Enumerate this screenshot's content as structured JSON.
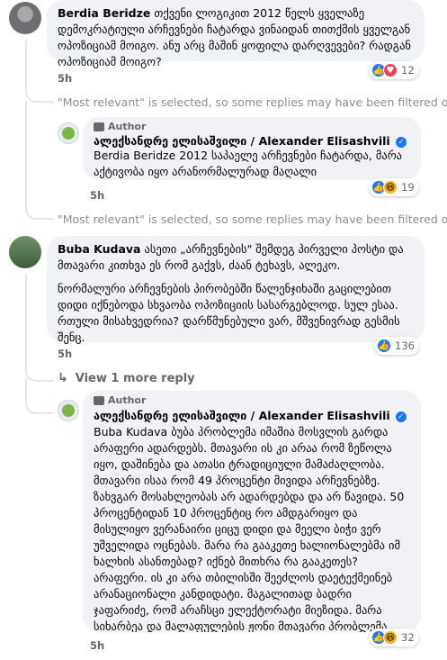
{
  "comment1": {
    "author": "Berdia Beridze",
    "text": "თქვენი ლოგიკით 2012 წელს ყველაზე დემოკრატიული არჩევნები ჩატარდა ვინაიდან თითქმის ყველგან ოპოზიციამ მოიგო. ანუ არც მაშინ ყოფილა დარღვევები? რადგან ოპოზიციამ მოიგო?",
    "time": "5h",
    "reactions": {
      "icons": [
        "like-icon",
        "love-icon"
      ],
      "count": "12"
    }
  },
  "filter_notice_1": "\"Most relevant\" is selected, so some replies may have been filtered out.",
  "reply1": {
    "badge": "Author",
    "author": "ალექსანდრე ელისაშვილი / Alexander Elisashvili",
    "text": "Berdia Beridze 2012 საპაელე არჩევნები ჩატარდა, მარა აქტივობა იყო არანორმალურად მაღალი",
    "time": "5h",
    "reactions": {
      "icons": [
        "like-icon",
        "haha-icon"
      ],
      "count": "19"
    }
  },
  "filter_notice_2": "\"Most relevant\" is selected, so some replies may have been filtered out.",
  "comment2": {
    "author": "Buba Kudava",
    "text_p1": "ასეთი „არჩევნების\" შემდეგ პირველი პოსტი და მთავარი კითხვა ეს რომ გაქვს, ძაან ტეხავს, ალეკო.",
    "text_p2": "ნორმალური არჩევნების პირობებში წალენჯიხაში გაცილებით დიდი იქნებოდა სხვაობა ოპოზიციის სასარგებლოდ. სულ ესაა. რთული მისახვედრია? დარწმუნებული ვარ, მშვენივრად გესმის შენც.",
    "time": "5h",
    "reactions": {
      "icons": [
        "like-icon"
      ],
      "count": "136"
    }
  },
  "view_more": "View 1 more reply",
  "reply2": {
    "badge": "Author",
    "author": "ალექსანდრე ელისაშვილი / Alexander Elisashvili",
    "text": "Buba Kudava ბუბა პრობლემა იმაშია მოსვლის გარდა არაფერი ადარდებს. მთავარი ის კი არაა რომ ზეწოლა იყო, დაშინება და ათასი ტრადიციული მამაძაღლობა. მთავარი ისაა რომ 49 პროცენტი მივიდა არჩევნებზე. ზახვგარ მოსახლეობას არ ადარდებდა და არ წავიდა. 50 პროცენტიდან 10 პროცენტიც რო ამდგარიყო და მისულიყო ვერანაირი ციცუ დიდი და მეელი ბიჭი ვერ უშველიდა ოცნებას. მარა რა გააკეთე ხალიონალებმა იმ ხალხის ასანთებად? იქნებ მითხრა რა გააკეთეს? არაფერი. ის კი არა თბილისში შეეძლოს დაეტექმეინებ არანაციონალი კანდიდატი. მაგალითად ბადრი ჯაფარიძე, რომ არაჩსცი ელექტორატი მიეზიდა. მარა სიხარბეა და მალაფულების ჟონი მთავარი პრობლემა ნაციების. ჰოდა ისაა რაცაა. ციცუ დღიდგეზე გადარალება იილია, საკუთარი შეცდომების აღიარება რთულია",
    "time": "5h",
    "reactions": {
      "icons": [
        "like-icon",
        "haha-icon"
      ],
      "count": "32"
    }
  }
}
